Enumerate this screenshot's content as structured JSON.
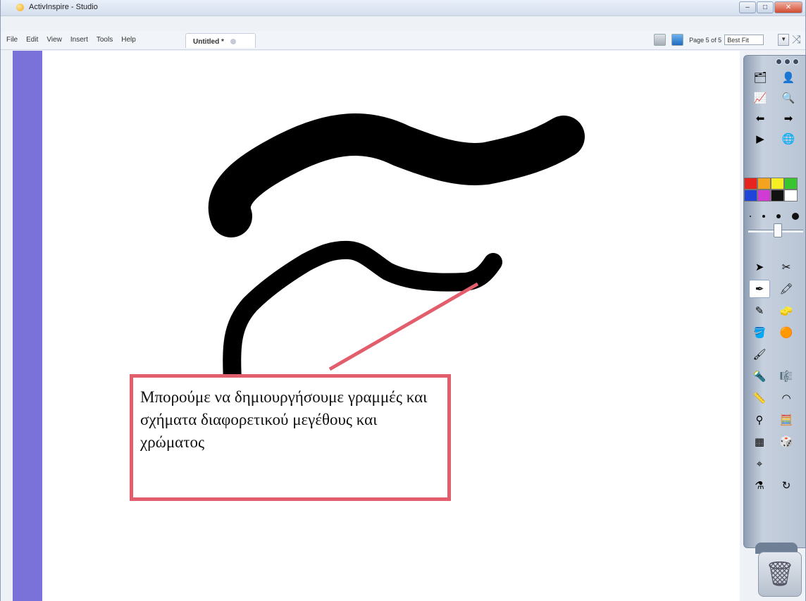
{
  "window": {
    "title": "ActivInspire - Studio",
    "buttons": [
      "minimize",
      "maximize",
      "close"
    ]
  },
  "menubar": {
    "items": [
      "File",
      "Edit",
      "View",
      "Insert",
      "Tools",
      "Help"
    ],
    "document_tab": "Untitled *",
    "page_indicator": "Page 5 of 5",
    "zoom": "Best Fit"
  },
  "canvas": {
    "background": "#ffffff",
    "left_strip_color": "#7a71d9",
    "stroke_color": "#000000",
    "callout_text": "Μπορούμε να δημιουργήσουμε γραμμές και σχήματα διαφορετικού μεγέθους και χρώματος",
    "callout_border_color": "#e35e6c"
  },
  "toolbox": {
    "tools": [
      [
        "flipchart-organiser-icon",
        "user-defined-icon"
      ],
      [
        "main-menu-icon",
        "browser-icon"
      ],
      [
        "previous-page-icon",
        "next-page-icon"
      ],
      [
        "play-icon",
        "desktop-annotate-icon"
      ],
      [
        "select-icon",
        "magic-ink-icon"
      ],
      [
        "pen-icon",
        "highlighter-icon"
      ],
      [
        "magic-ink-pen-icon",
        "eraser-icon"
      ],
      [
        "fill-icon",
        "shape-icon"
      ],
      [
        "connector-icon",
        "empty"
      ],
      [
        "spotlight-icon",
        "revealer-icon"
      ],
      [
        "ruler-icon",
        "protractor-icon"
      ],
      [
        "compass-icon",
        "calculator-icon"
      ],
      [
        "grid-icon",
        "dice-icon"
      ],
      [
        "clicker-icon",
        "empty"
      ],
      [
        "voting-icon",
        "reset-icon"
      ]
    ],
    "palette": [
      [
        "#e6231f",
        "#f4a31e",
        "#f5ef23",
        "#39c52d"
      ],
      [
        "#1e45d8",
        "#d03bd6",
        "#111111",
        "#ffffff"
      ]
    ]
  }
}
